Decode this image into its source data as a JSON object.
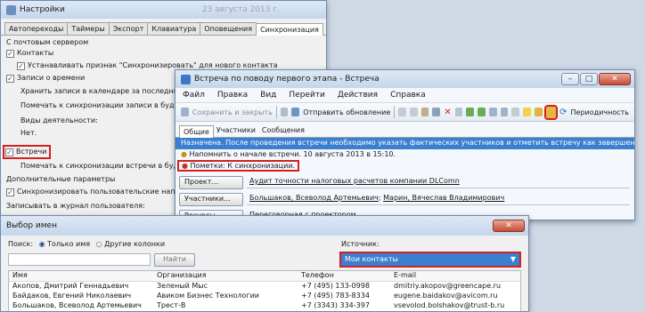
{
  "settings": {
    "title": "Настройки",
    "title_date": "23 августа 2013 г.",
    "tabs": [
      "Автопереходы",
      "Таймеры",
      "Экспорт",
      "Клавиатура",
      "Оповещения",
      "Синхронизация"
    ],
    "mail_server": "С почтовым сервером",
    "contacts": "Контакты",
    "set_flag": "Устанавливать признак \"Синхронизировать\" для нового контакта",
    "time_records": "Записи о времени",
    "keep_records": "Хранить записи в календаре за последние:",
    "mark_records": "Помечать к синхронизации записи в будущем:",
    "activity_types": "Виды деятельности:",
    "no": "Нет.",
    "meetings": "Встречи",
    "mark_meetings": "Помечать к синхронизации встречи в будущем:",
    "extra_params": "Дополнительные параметры",
    "sync_user": "Синхронизировать пользовательские напоминания",
    "write_log": "Записывать в журнал пользователя:"
  },
  "meeting": {
    "title": "Встреча по поводу первого этапа - Встреча",
    "menu": [
      "Файл",
      "Правка",
      "Вид",
      "Перейти",
      "Действия",
      "Справка"
    ],
    "toolbar": {
      "save_close": "Сохранить и закрыть",
      "send_update": "Отправить обновление",
      "periodicity": "Периодичность"
    },
    "tabs": [
      "Общие",
      "Участники",
      "Сообщения"
    ],
    "info": "Назначена. После проведения встречи необходимо указать фактических участников и отметить встречу как завершенную.",
    "reminder": "Напомнить о начале встречи. 10 августа 2013 в 15:10.",
    "note": "Пометки: К синхронизации.",
    "project_label": "Проект...",
    "project_value": "Аудит точности налоговых расчетов компании DLComn",
    "participants_label": "Участники...",
    "participants_value_1": "Большаков, Всеволод Артемьевич",
    "participants_value_2": "Марин, Вячеслав Владимирович",
    "resources_label": "Ресурсы...",
    "resources_value": "Переговорная с проектором"
  },
  "picker": {
    "title": "Выбор имен",
    "search_label": "Поиск:",
    "only_name": "Только имя",
    "other_columns": "Другие колонки",
    "find": "Найти",
    "source_label": "Источник:",
    "source_value": "Мои контакты",
    "columns": [
      "Имя",
      "Организация",
      "Телефон",
      "E-mail"
    ],
    "rows": [
      [
        "Акопов, Дмитрий Геннадьевич",
        "Зеленый Мыс",
        "+7 (495) 133-0998",
        "dmitriy.akopov@greencape.ru"
      ],
      [
        "Байдаков, Евгений Николаевич",
        "Авиком Бизнес Технологии",
        "+7 (495) 783-8334",
        "eugene.baidakov@avicom.ru"
      ],
      [
        "Большаков, Всеволод Артемьевич",
        "Трест-В",
        "+7 (3343) 334-397",
        "vsevolod.bolshakov@trust-b.ru"
      ]
    ]
  }
}
